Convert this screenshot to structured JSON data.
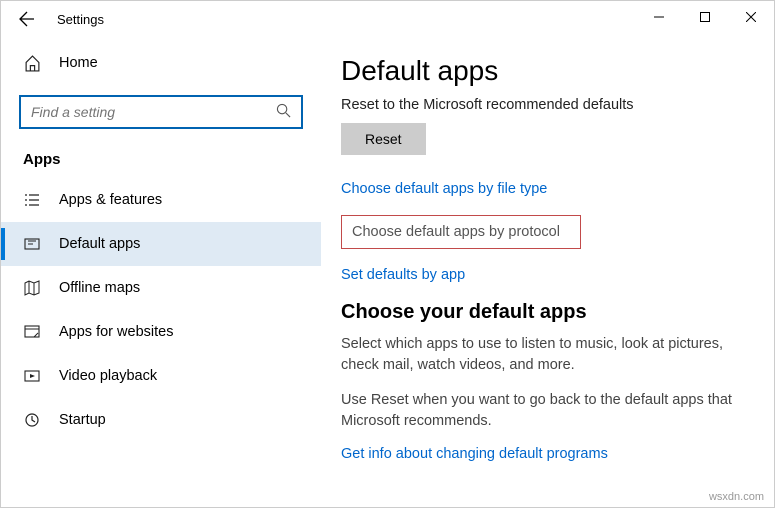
{
  "window": {
    "title": "Settings"
  },
  "sidebar": {
    "home_label": "Home",
    "search_placeholder": "Find a setting",
    "section_label": "Apps",
    "items": [
      {
        "label": "Apps & features"
      },
      {
        "label": "Default apps"
      },
      {
        "label": "Offline maps"
      },
      {
        "label": "Apps for websites"
      },
      {
        "label": "Video playback"
      },
      {
        "label": "Startup"
      }
    ]
  },
  "main": {
    "heading": "Default apps",
    "reset_caption": "Reset to the Microsoft recommended defaults",
    "reset_button": "Reset",
    "link_filetype": "Choose default apps by file type",
    "link_protocol": "Choose default apps by protocol",
    "link_byapp": "Set defaults by app",
    "choose_heading": "Choose your default apps",
    "choose_para": "Select which apps to use to listen to music, look at pictures, check mail, watch videos, and more.",
    "reset_para": "Use Reset when you want to go back to the default apps that Microsoft recommends.",
    "info_link": "Get info about changing default programs"
  },
  "watermark": "wsxdn.com"
}
